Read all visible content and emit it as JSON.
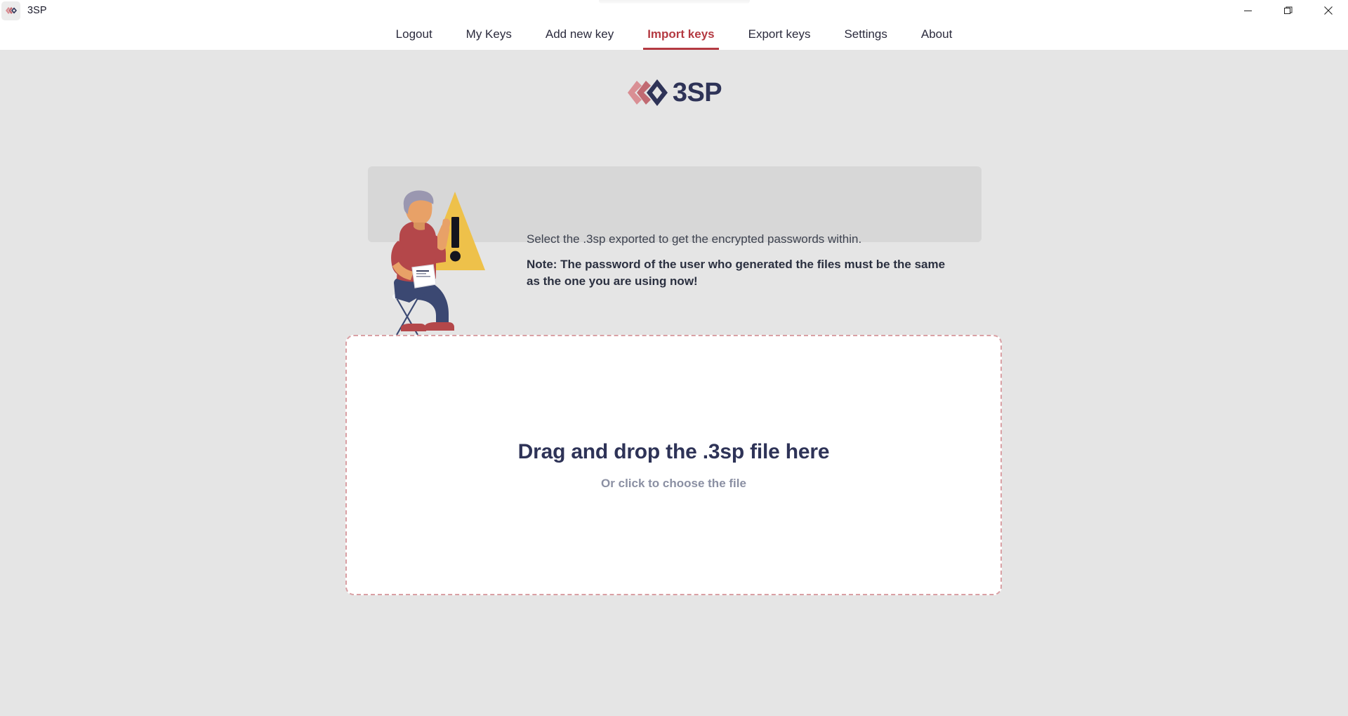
{
  "window": {
    "title": "3SP",
    "app_icon": "3sp-logo-icon",
    "controls": [
      {
        "name": "minimize-button",
        "icon": "minimize-icon"
      },
      {
        "name": "restore-button",
        "icon": "restore-icon"
      },
      {
        "name": "close-button",
        "icon": "close-icon"
      }
    ]
  },
  "nav": {
    "items": [
      {
        "label": "Logout",
        "active": false
      },
      {
        "label": "My Keys",
        "active": false
      },
      {
        "label": "Add new key",
        "active": false
      },
      {
        "label": "Import keys",
        "active": true
      },
      {
        "label": "Export keys",
        "active": false
      },
      {
        "label": "Settings",
        "active": false
      },
      {
        "label": "About",
        "active": false
      }
    ],
    "active_label": "Import keys"
  },
  "brand": {
    "text": "3SP",
    "mark": "chevron-diamond-logo-icon"
  },
  "notice": {
    "illustration": "person-pointing-at-warning-sign-illustration",
    "line1": "Select the .3sp exported to get the encrypted passwords within.",
    "line2": "Note: The password of the user who generated the files must be the same as the one you are using now!"
  },
  "dropzone": {
    "title": "Drag and drop the .3sp file here",
    "subtitle": "Or click to choose the file"
  },
  "colors": {
    "accent_red": "#b43a42",
    "brand_navy": "#2e3357",
    "brand_pink": "#cf8085",
    "page_bg": "#e5e5e5",
    "notice_bg": "#d7d7d7",
    "dropzone_border": "#d9a0a4",
    "warning_yellow": "#eec14a",
    "muted_text": "#8b90a3"
  }
}
